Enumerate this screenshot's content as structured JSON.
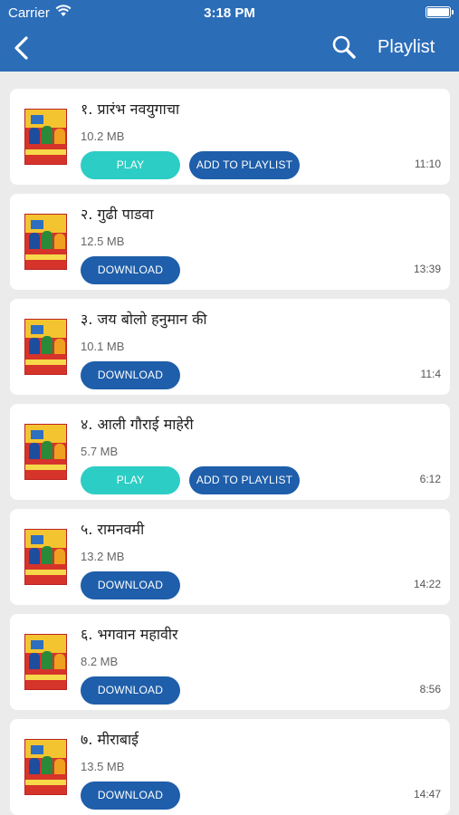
{
  "status": {
    "carrier": "Carrier",
    "time": "3:18 PM"
  },
  "nav": {
    "back_icon": "back-chevron-icon",
    "search_icon": "search-icon",
    "playlist_label": "Playlist"
  },
  "labels": {
    "play": "PLAY",
    "add_to_playlist": "ADD TO PLAYLIST",
    "download": "DOWNLOAD"
  },
  "colors": {
    "header": "#2c6db8",
    "primary_button": "#1e5eaa",
    "play_button": "#2ccdc4",
    "background": "#ebebeb"
  },
  "songs": [
    {
      "title": "१. प्रारंभ नवयुगाचा",
      "size": "10.2 MB",
      "duration": "11:10",
      "downloaded": true
    },
    {
      "title": "२. गुढी पाडवा",
      "size": "12.5 MB",
      "duration": "13:39",
      "downloaded": false
    },
    {
      "title": "३. जय बोलो हनुमान की",
      "size": "10.1 MB",
      "duration": "11:4",
      "downloaded": false
    },
    {
      "title": "४. आली गौराई माहेरी",
      "size": "5.7 MB",
      "duration": "6:12",
      "downloaded": true
    },
    {
      "title": "५. रामनवमी",
      "size": "13.2 MB",
      "duration": "14:22",
      "downloaded": false
    },
    {
      "title": "६. भगवान महावीर",
      "size": "8.2 MB",
      "duration": "8:56",
      "downloaded": false
    },
    {
      "title": "७. मीराबाई",
      "size": "13.5 MB",
      "duration": "14:47",
      "downloaded": false
    }
  ]
}
